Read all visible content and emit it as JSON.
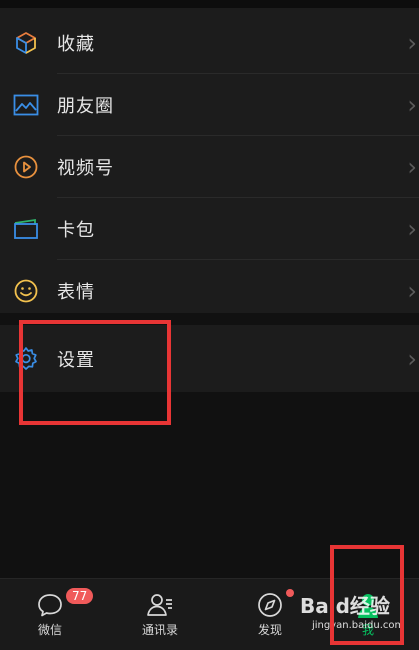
{
  "menu": {
    "items": [
      {
        "label": "收藏",
        "icon": "favorites-cube-icon"
      },
      {
        "label": "朋友圈",
        "icon": "moments-image-icon"
      },
      {
        "label": "视频号",
        "icon": "channels-play-icon"
      },
      {
        "label": "卡包",
        "icon": "card-wallet-icon"
      },
      {
        "label": "表情",
        "icon": "sticker-smile-icon"
      }
    ],
    "settings": {
      "label": "设置",
      "icon": "gear-icon"
    }
  },
  "tabbar": {
    "tabs": [
      {
        "label": "微信",
        "badge": "77",
        "icon": "chat-bubble-icon"
      },
      {
        "label": "通讯录",
        "icon": "contacts-icon"
      },
      {
        "label": "发现",
        "icon": "compass-icon"
      },
      {
        "label": "我",
        "icon": "profile-person-icon"
      }
    ]
  },
  "watermark": {
    "text": "Baid经验",
    "sub": "jingyan.baidu.com"
  },
  "colors": {
    "accent_green": "#07c160",
    "highlight_red": "#e83535",
    "badge_red": "#f05a5a"
  }
}
